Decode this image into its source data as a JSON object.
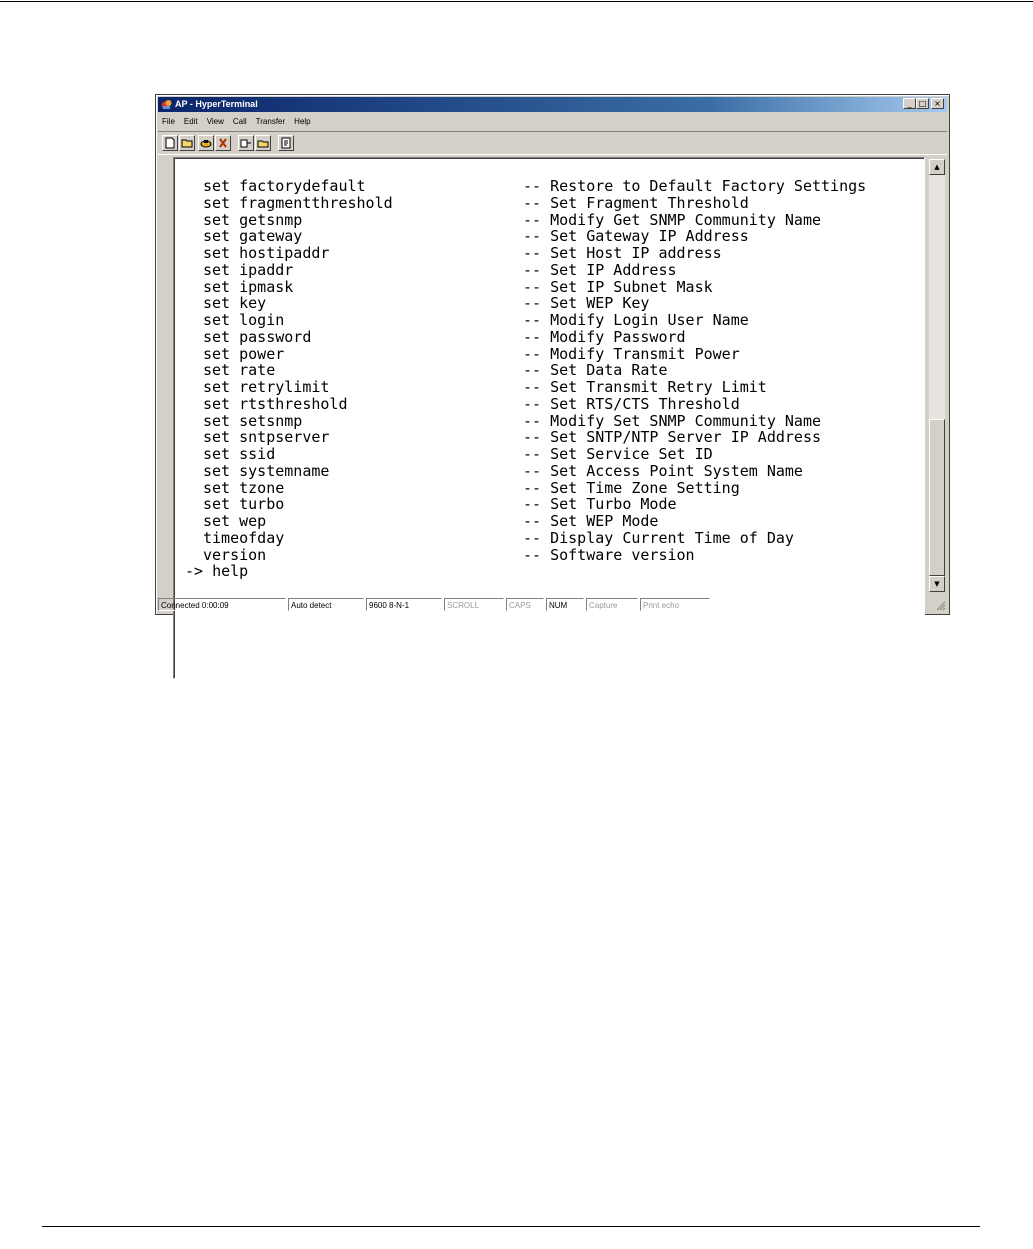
{
  "window": {
    "title": "AP - HyperTerminal",
    "controls": {
      "minimize": "_",
      "maximize": "□",
      "close": "×"
    }
  },
  "menu": [
    "File",
    "Edit",
    "View",
    "Call",
    "Transfer",
    "Help"
  ],
  "toolbar": {
    "icons": [
      "new-icon",
      "open-icon",
      "call-icon",
      "disconnect-icon",
      "send-icon",
      "receive-icon",
      "properties-icon"
    ]
  },
  "terminal": {
    "lines": [
      {
        "cmd": "set factorydefault",
        "desc": "-- Restore to Default Factory Settings"
      },
      {
        "cmd": "set fragmentthreshold",
        "desc": "-- Set Fragment Threshold"
      },
      {
        "cmd": "set getsnmp",
        "desc": "-- Modify Get SNMP Community Name"
      },
      {
        "cmd": "set gateway",
        "desc": "-- Set Gateway IP Address"
      },
      {
        "cmd": "set hostipaddr",
        "desc": "-- Set Host IP address"
      },
      {
        "cmd": "set ipaddr",
        "desc": "-- Set IP Address"
      },
      {
        "cmd": "set ipmask",
        "desc": "-- Set IP Subnet Mask"
      },
      {
        "cmd": "set key",
        "desc": "-- Set WEP Key"
      },
      {
        "cmd": "set login",
        "desc": "-- Modify Login User Name"
      },
      {
        "cmd": "set password",
        "desc": "-- Modify Password"
      },
      {
        "cmd": "set power",
        "desc": "-- Modify Transmit Power"
      },
      {
        "cmd": "set rate",
        "desc": "-- Set Data Rate"
      },
      {
        "cmd": "set retrylimit",
        "desc": "-- Set Transmit Retry Limit"
      },
      {
        "cmd": "set rtsthreshold",
        "desc": "-- Set RTS/CTS Threshold"
      },
      {
        "cmd": "set setsnmp",
        "desc": "-- Modify Set SNMP Community Name"
      },
      {
        "cmd": "set sntpserver",
        "desc": "-- Set SNTP/NTP Server IP Address"
      },
      {
        "cmd": "set ssid",
        "desc": "-- Set Service Set ID"
      },
      {
        "cmd": "set systemname",
        "desc": "-- Set Access Point System Name"
      },
      {
        "cmd": "set tzone",
        "desc": "-- Set Time Zone Setting"
      },
      {
        "cmd": "set turbo",
        "desc": "-- Set Turbo Mode"
      },
      {
        "cmd": "set wep",
        "desc": "-- Set WEP Mode"
      },
      {
        "cmd": "timeofday",
        "desc": "-- Display Current Time of Day"
      },
      {
        "cmd": "version",
        "desc": "-- Software version"
      }
    ],
    "prompt": "-> help"
  },
  "statusbar": {
    "connected": "Connected 0:00:09",
    "detect": "Auto detect",
    "settings": "9600 8-N-1",
    "scroll": "SCROLL",
    "caps": "CAPS",
    "num": "NUM",
    "capture": "Capture",
    "print_echo": "Print echo"
  },
  "colors": {
    "title_gradient_start": "#0a246a",
    "title_gradient_end": "#a6caf0",
    "chrome": "#d4d0c8"
  }
}
